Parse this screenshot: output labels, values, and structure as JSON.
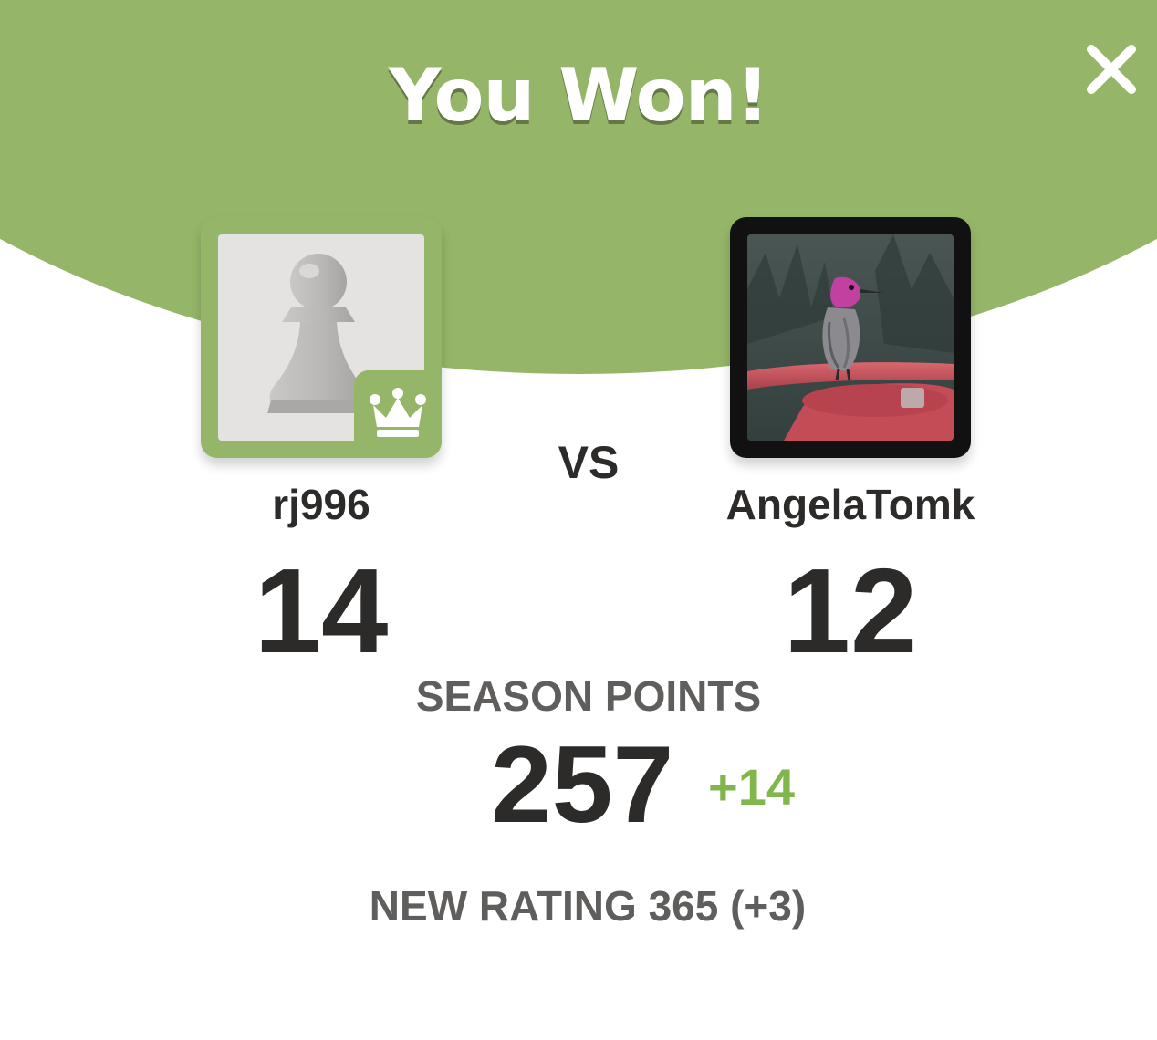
{
  "header": {
    "title": "You Won!",
    "background_color": "#95b668",
    "close_icon": "close-icon"
  },
  "players": {
    "left": {
      "username": "rj996",
      "score": "14",
      "avatar": "pawn-icon",
      "badge": "crown-icon",
      "border_color": "#95b668"
    },
    "right": {
      "username": "AngelaTomk",
      "score": "12",
      "avatar": "hummingbird-photo",
      "border_color": "#111111"
    }
  },
  "vs_label": "VS",
  "season": {
    "label": "SEASON POINTS",
    "value": "257",
    "delta": "+14",
    "delta_color": "#81b64c"
  },
  "rating": {
    "text": "NEW RATING 365 (+3)"
  }
}
